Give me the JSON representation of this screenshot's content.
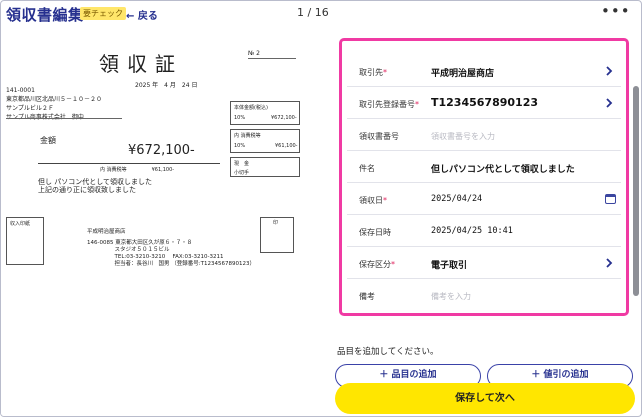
{
  "header": {
    "title": "領収書編集",
    "badge": "要チェック",
    "back_label": "← 戻る",
    "page_counter": "1 / 16",
    "more_label": "•••"
  },
  "receipt": {
    "title": "領収証",
    "number_label": "№ 2",
    "date": "2025 年　4 月　24 日",
    "address": [
      "141-0001",
      "東京都品川区北品川５－１０－２０",
      "サンプルビル２Ｆ",
      "サンプル商事株式会社　御中"
    ],
    "amount_label": "金額",
    "amount": "¥672,100-",
    "tax_small": "内 消費税等　　　　　¥61,100-",
    "description": [
      "但し パソコン代として領収しました",
      "上記の通り正に領収致しました"
    ],
    "box1_title": "本体金額(税込)",
    "box1_rate": "10%",
    "box1_value": "¥672,100-",
    "box2_title": "内 消費税等",
    "box2_rate": "10%",
    "box2_value": "¥61,100-",
    "box3_label1": "現　金",
    "box3_label2": "小切手",
    "stamp_label": "収入印紙",
    "seal_label": "印",
    "shop_lines": [
      "平成明治屋商店",
      "",
      "146-0085 東京都大田区久が原６・７・８",
      "　　　　　スタジオ５０１５ビル",
      "　　　　　TEL:03-3210-3210　 FAX:03-3210-3211",
      "　　　　　担当者：長谷川　国男 （登録番号:T1234567890123）"
    ]
  },
  "form": {
    "rows": [
      {
        "label": "取引先",
        "required": "*",
        "value": "平成明治屋商店"
      },
      {
        "label": "取引先登録番号",
        "required": "*",
        "value": "T1234567890123"
      },
      {
        "label": "領収書番号",
        "required": "",
        "placeholder": "領収書番号を入力"
      },
      {
        "label": "件名",
        "required": "",
        "value": "但しパソコン代として領収しました"
      },
      {
        "label": "領収日",
        "required": "*",
        "value": "2025/04/24"
      },
      {
        "label": "保存日時",
        "required": "",
        "value": "2025/04/25 10:41"
      },
      {
        "label": "保存区分",
        "required": "*",
        "value": "電子取引"
      },
      {
        "label": "備考",
        "required": "",
        "placeholder": "備考を入力"
      }
    ]
  },
  "items": {
    "message": "品目を追加してください。",
    "add_item_label": "＋ 品目の追加",
    "add_discount_label": "＋ 値引の追加"
  },
  "footer": {
    "save_next_label": "保存して次へ"
  },
  "colors": {
    "brand": "#26308f",
    "highlight_border": "#f03aa3",
    "badge_bg": "#ffe66a",
    "save_button": "#ffe600",
    "required": "#e0245e"
  }
}
